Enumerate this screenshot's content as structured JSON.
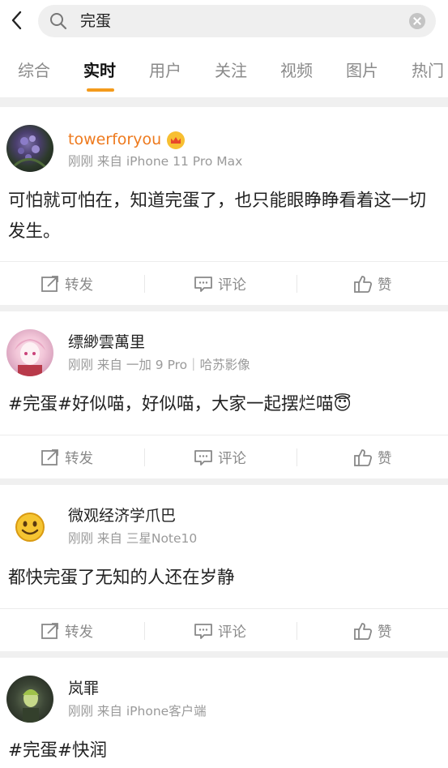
{
  "search": {
    "query": "完蛋"
  },
  "tabs": [
    {
      "label": "综合"
    },
    {
      "label": "实时"
    },
    {
      "label": "用户"
    },
    {
      "label": "关注"
    },
    {
      "label": "视频"
    },
    {
      "label": "图片"
    },
    {
      "label": "热门"
    }
  ],
  "active_tab": "实时",
  "accent_color": "#f49b1c",
  "username_vip_color": "#ee7a1e",
  "action_labels": {
    "repost": "转发",
    "comment": "评论",
    "like": "赞"
  },
  "posts": [
    {
      "username": "towerforyou",
      "meta": "刚刚 来自 iPhone 11 Pro Max",
      "text": "可怕就可怕在，知道完蛋了，也只能眼睁睁看着这一切发生。"
    },
    {
      "username": "缥緲雲萬里",
      "meta": "刚刚 来自 一加 9 Pro｜哈苏影像",
      "text": "#完蛋#好似喵，好似喵，大家一起摆烂喵😇"
    },
    {
      "username": "微观经济学爪巴",
      "meta": "刚刚 来自 三星Note10",
      "text": "都快完蛋了无知的人还在岁静"
    },
    {
      "username": "岚罪",
      "meta": "刚刚 来自 iPhone客户端",
      "text": "#完蛋#快润"
    }
  ]
}
